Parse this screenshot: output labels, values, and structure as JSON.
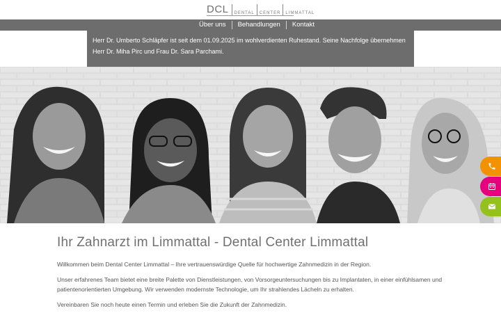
{
  "header": {
    "logo_mark": "DCL",
    "logo_words": [
      "DENTAL",
      "CENTER",
      "LIMMATTAL"
    ]
  },
  "nav": {
    "items": [
      "Über uns",
      "Behandlungen",
      "Kontakt"
    ]
  },
  "notice": {
    "text": "Herr Dr. Umberto Schläpfer ist seit dem 01.09.2025 im wohlverdienten Ruhestand. Seine Nachfolge übernehmen Herr Dr. Miha Pirc und Frau Dr. Sara Parchami."
  },
  "hero": {
    "slide_count": 5
  },
  "contact_buttons": {
    "phone_icon": "phone-icon",
    "calendar_icon": "calendar-icon",
    "mail_icon": "mail-icon",
    "colors": {
      "phone": "#f39200",
      "calendar": "#e6007e",
      "mail": "#95c11f"
    }
  },
  "main": {
    "title": "Ihr Zahnarzt im Limmattal - Dental Center Limmattal",
    "paragraphs": [
      "Willkommen beim Dental Center Limmattal – Ihre vertrauenswürdige Quelle für hochwertige Zahnmedizin in der Region.",
      "Unser erfahrenes Team bietet eine breite Palette von Dienstleistungen, von Vorsorgeuntersuchungen bis zu Implantaten, in einer einfühlsamen und patientenorientierten Umgebung. Wir verwenden modernste Technologie, um Ihr strahlendes Lächeln zu erhalten.",
      "Vereinbaren Sie noch heute einen Termin und erleben Sie die Zukunft der Zahnmedizin."
    ]
  }
}
